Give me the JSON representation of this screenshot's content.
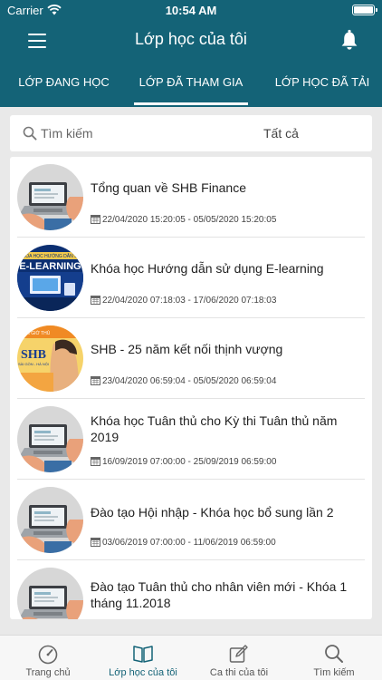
{
  "status_bar": {
    "carrier": "Carrier",
    "time": "10:54 AM"
  },
  "header": {
    "title": "Lớp học của tôi"
  },
  "tabs": [
    {
      "label": "Lớp đang học",
      "active": false
    },
    {
      "label": "Lớp đã tham gia",
      "active": true
    },
    {
      "label": "Lớp học đã tải",
      "active": false
    }
  ],
  "search": {
    "placeholder": "Tìm kiếm",
    "value": "",
    "filter_label": "Tất cả"
  },
  "courses": [
    {
      "title": "Tổng quan về SHB Finance",
      "date_range": "22/04/2020 15:20:05 - 05/05/2020 15:20:05",
      "thumbnail": "laptop"
    },
    {
      "title": "Khóa học Hướng dẫn sử dụng E-learning",
      "date_range": "22/04/2020 07:18:03 - 17/06/2020 07:18:03",
      "thumbnail": "elearning-banner"
    },
    {
      "title": "SHB - 25 năm kết nối thịnh vượng",
      "date_range": "23/04/2020 06:59:04 - 05/05/2020 06:59:04",
      "thumbnail": "shb-banner"
    },
    {
      "title": "Khóa học Tuân thủ cho Kỳ thi Tuân thủ năm 2019",
      "date_range": "16/09/2019 07:00:00 - 25/09/2019 06:59:00",
      "thumbnail": "laptop"
    },
    {
      "title": "Đào tạo Hội nhập - Khóa học bổ sung lần 2",
      "date_range": "03/06/2019 07:00:00 - 11/06/2019 06:59:00",
      "thumbnail": "laptop"
    },
    {
      "title": "Đào tạo Tuân thủ cho nhân viên mới - Khóa 1 tháng 11.2018",
      "date_range": "",
      "thumbnail": "laptop"
    }
  ],
  "thumb_text": {
    "elearning_top": "KHÓA HỌC HƯỚNG DẪN SỬ",
    "elearning_word": "E-LEARNING",
    "shb_top": "BẮN GIỜ THỦ",
    "shb_word": "SHB",
    "shb_sub": "SÀI GÒN - HÀ NỘI"
  },
  "bottom_nav": [
    {
      "label": "Trang chủ",
      "icon": "gauge-icon",
      "active": false
    },
    {
      "label": "Lớp học của tôi",
      "icon": "book-icon",
      "active": true
    },
    {
      "label": "Ca thi của tôi",
      "icon": "edit-icon",
      "active": false
    },
    {
      "label": "Tìm kiếm",
      "icon": "search-icon",
      "active": false
    }
  ],
  "colors": {
    "primary": "#146377",
    "background": "#e9e9e9",
    "card": "#ffffff"
  }
}
